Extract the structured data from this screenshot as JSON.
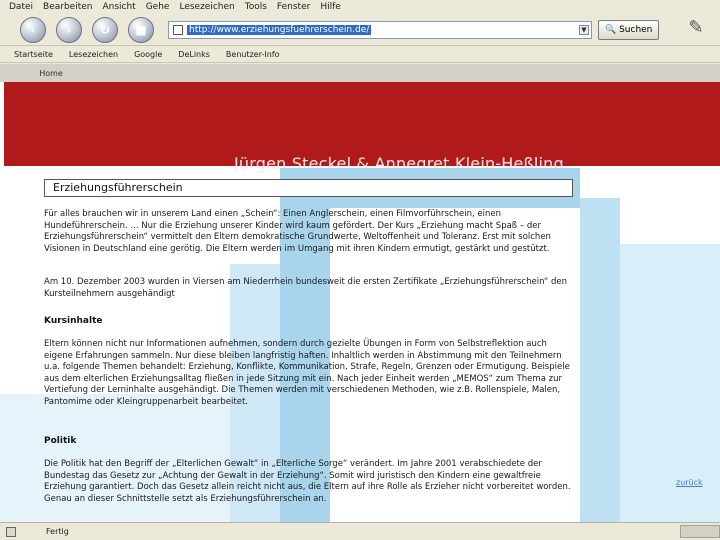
{
  "menu": [
    "Datei",
    "Bearbeiten",
    "Ansicht",
    "Gehe",
    "Lesezeichen",
    "Tools",
    "Fenster",
    "Hilfe"
  ],
  "nav": {
    "back": "‹",
    "forward": "›",
    "reload": "↻",
    "stop": "■",
    "url": "http://www.erziehungsfuehrerschein.de/",
    "search_label": "Suchen"
  },
  "bookmarks": [
    "Startseite",
    "Lesezeichen",
    "Google",
    "DeLinks",
    "Benutzer-Info"
  ],
  "tab": {
    "home": "Home"
  },
  "banner": {
    "title": "Jürgen Steckel &  Annegret Klein-Heßling"
  },
  "content": {
    "heading": "Erziehungsführerschein",
    "p1": "Für alles brauchen wir in unserem Land einen „Schein“: Einen Anglerschein, einen Filmvorführschein, einen Hundeführerschein. ... Nur die Erziehung unserer Kinder wird kaum gefördert. Der Kurs „Erziehung macht Spaß – der Erziehungsführerschein“ vermittelt den Eltern demokratische Grundwerte, Weltoffenheit und Toleranz. Erst mit solchen Visionen in Deutschland eine gerötig. Die Eltern werden im Umgang mit ihren Kindern ermutigt, gestärkt und gestützt.",
    "p2": "Am 10. Dezember 2003 wurden in Viersen am Niederrhein bundesweit die ersten Zertifikate „Erziehungsführerschein“ den Kursteilnehmern ausgehändigt",
    "h_kurs": "Kursinhalte",
    "p3": "Eltern können nicht nur Informationen aufnehmen, sondern durch gezielte Übungen in Form von Selbstreflektion auch eigene Erfahrungen sammeln. Nur diese bleiben langfristig haften. Inhaltlich werden in Abstimmung mit den Teilnehmern u.a. folgende Themen behandelt: Erziehung, Konflikte, Kommunikation, Strafe, Regeln, Grenzen oder Ermutigung. Beispiele aus dem elterlichen Erziehungsalltag fließen in jede Sitzung mit ein. Nach jeder Einheit werden „MEMOS“ zum Thema zur Vertiefung der Lerninhalte ausgehändigt. Die Themen werden mit verschiedenen Methoden, wie z.B. Rollenspiele, Malen, Pantomime oder Kleingruppenarbeit bearbeitet.",
    "h_politik": "Politik",
    "p4": "Die Politik hat den Begriff der „Elterlichen Gewalt“ in „Elterliche Sorge“ verändert. Im Jahre 2001 verabschiedete der Bundestag das Gesetz zur „Achtung der Gewalt in der Erziehung“. Somit wird juristisch den Kindern eine gewaltfreie Erziehung garantiert. Doch das Gesetz allein reicht nicht aus, die Eltern auf ihre Rolle als Erzieher nicht vorbereitet worden. Genau an dieser Schnittstelle setzt als Erziehungsführerschein an.",
    "zurueck": "zurück"
  },
  "statusbar": {
    "text": "Fertig"
  }
}
